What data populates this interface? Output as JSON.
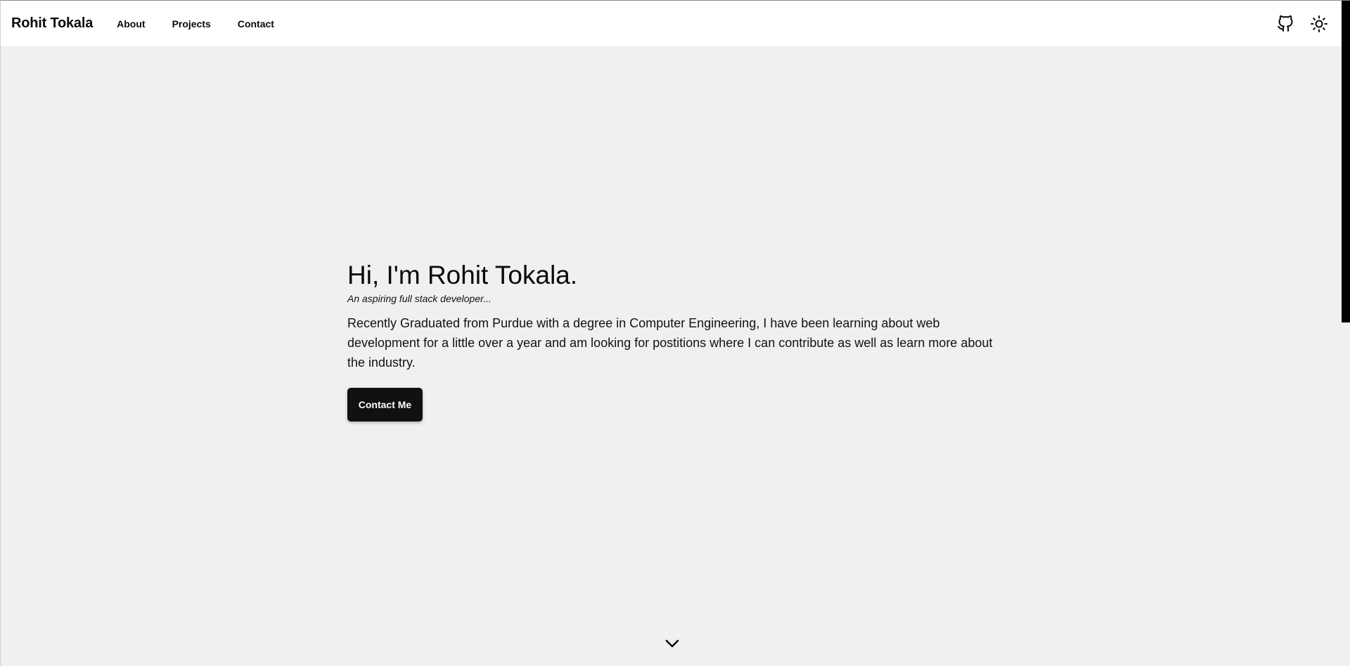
{
  "header": {
    "brand": "Rohit Tokala",
    "nav": [
      {
        "label": "About"
      },
      {
        "label": "Projects"
      },
      {
        "label": "Contact"
      }
    ],
    "actions": [
      {
        "icon": "github-icon"
      },
      {
        "icon": "sun-icon"
      }
    ]
  },
  "hero": {
    "title": "Hi, I'm Rohit Tokala.",
    "tagline": "An aspiring full stack developer...",
    "body": "Recently Graduated from Purdue with a degree in Computer Engineering, I have been learning about web development for a little over a year and am looking for postitions where I can contribute as well as learn more about the industry.",
    "cta_label": "Contact Me"
  },
  "scroll_indicator": {
    "icon": "chevron-down-icon"
  },
  "colors": {
    "background": "#f0f0f0",
    "header_bg": "#ffffff",
    "text": "#0a0a0a",
    "button_bg": "#111111",
    "button_text": "#ffffff"
  }
}
